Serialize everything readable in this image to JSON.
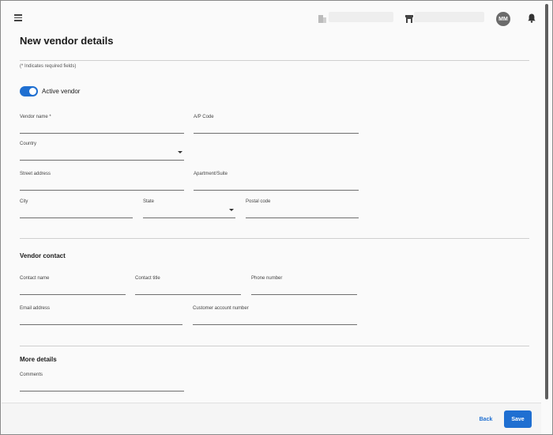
{
  "header": {
    "avatar_initials": "MM",
    "icons": [
      "menu-icon",
      "building-icon",
      "store-icon",
      "bell-icon"
    ]
  },
  "page": {
    "title": "New vendor details",
    "required_note": "(* Indicates required fields)"
  },
  "active_toggle": {
    "label": "Active vendor",
    "checked": true,
    "color": "#1f6fd1"
  },
  "vendor_fields": {
    "vendor_name": "Vendor name *",
    "ap_code": "A/P Code",
    "country": "Country",
    "street_address": "Street address",
    "apartment_suite": "Apartment/Suite",
    "city": "City",
    "state": "State",
    "postal_code": "Postal code"
  },
  "vendor_contact": {
    "heading": "Vendor contact",
    "contact_name": "Contact name",
    "contact_title": "Contact title",
    "phone_number": "Phone number",
    "email_address": "Email address",
    "customer_account_number": "Customer account number"
  },
  "more_details": {
    "heading": "More details",
    "comments": "Comments"
  },
  "footer": {
    "back_label": "Back",
    "save_label": "Save",
    "accent": "#1f6fd1"
  }
}
